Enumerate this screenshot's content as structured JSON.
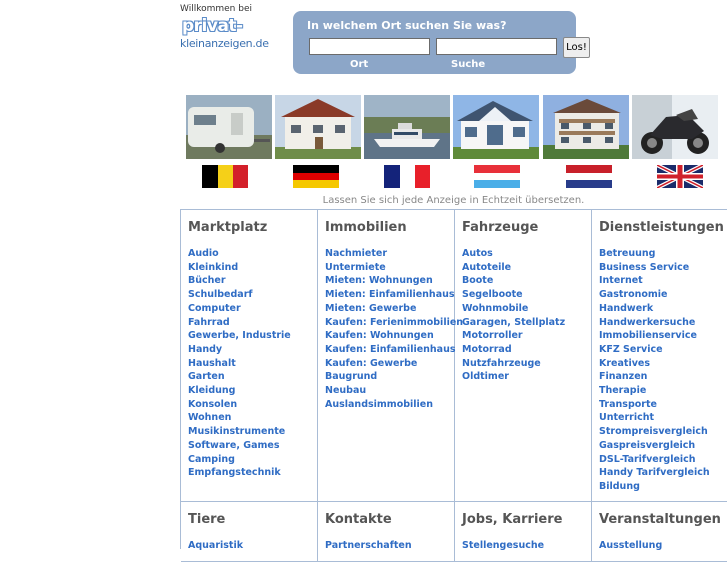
{
  "header": {
    "welcome": "Willkommen bei",
    "logo_line1": "privat-",
    "logo_line2": "kleinanzeigen.de"
  },
  "search": {
    "question": "In welchem Ort suchen Sie was?",
    "ort_value": "",
    "suche_value": "",
    "button": "Los!",
    "label_ort": "Ort",
    "label_suche": "Suche"
  },
  "photos": [
    "caravan",
    "house",
    "motor-boat",
    "modern-house",
    "apartment-building",
    "motorcycle"
  ],
  "flags": [
    "belgium",
    "germany",
    "france",
    "luxembourg",
    "netherlands",
    "united-kingdom"
  ],
  "translate_text": "Lassen Sie sich jede Anzeige in Echtzeit übersetzen.",
  "categories": [
    {
      "title": "Marktplatz",
      "links": [
        "Audio",
        "Kleinkind",
        "Bücher",
        "Schulbedarf",
        "Computer",
        "Fahrrad",
        "Gewerbe, Industrie",
        "Handy",
        "Haushalt",
        "Garten",
        "Kleidung",
        "Konsolen",
        "Wohnen",
        "Musikinstrumente",
        "Software, Games",
        "Camping",
        "Empfangstechnik"
      ]
    },
    {
      "title": "Immobilien",
      "links": [
        "Nachmieter",
        "Untermiete",
        "Mieten: Wohnungen",
        "Mieten: Einfamilienhaus",
        "Mieten: Gewerbe",
        "Kaufen: Ferienimmobilien",
        "Kaufen: Wohnungen",
        "Kaufen: Einfamilienhaus",
        "Kaufen: Gewerbe",
        "Baugrund",
        "Neubau",
        "Auslandsimmobilien"
      ]
    },
    {
      "title": "Fahrzeuge",
      "links": [
        "Autos",
        "Autoteile",
        "Boote",
        "Segelboote",
        "Wohnmobile",
        "Garagen, Stellplatz",
        "Motorroller",
        "Motorrad",
        "Nutzfahrzeuge",
        "Oldtimer"
      ]
    },
    {
      "title": "Dienstleistungen",
      "links": [
        "Betreuung",
        "Business Service",
        "Internet",
        "Gastronomie",
        "Handwerk",
        "Handwerkersuche",
        "Immobilienservice",
        "KFZ Service",
        "Kreatives",
        "Finanzen",
        "Therapie",
        "Transporte",
        "Unterricht",
        "Strompreisvergleich",
        "Gaspreisvergleich",
        "DSL-Tarifvergleich",
        "Handy Tarifvergleich",
        "Bildung"
      ]
    },
    {
      "title": "Tiere",
      "links": [
        "Aquaristik"
      ]
    },
    {
      "title": "Kontakte",
      "links": [
        "Partnerschaften"
      ]
    },
    {
      "title": "Jobs, Karriere",
      "links": [
        "Stellengesuche"
      ]
    },
    {
      "title": "Veranstaltungen",
      "links": [
        "Ausstellung"
      ]
    }
  ]
}
